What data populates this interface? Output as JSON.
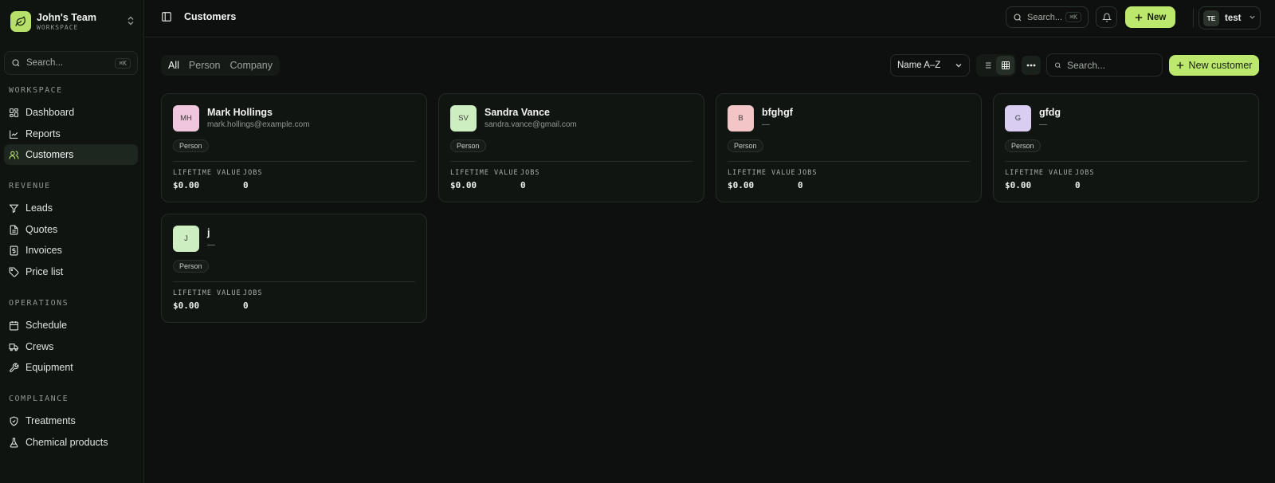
{
  "workspace": {
    "name": "John's Team",
    "label": "WORKSPACE"
  },
  "sidebar": {
    "search_label": "Search...",
    "search_shortcut": "⌘K",
    "sections": [
      {
        "title": "WORKSPACE",
        "items": [
          {
            "label": "Dashboard",
            "icon": "dashboard-icon"
          },
          {
            "label": "Reports",
            "icon": "chart-line-icon"
          },
          {
            "label": "Customers",
            "icon": "users-icon",
            "active": true
          }
        ]
      },
      {
        "title": "REVENUE",
        "items": [
          {
            "label": "Leads",
            "icon": "filter-icon"
          },
          {
            "label": "Quotes",
            "icon": "document-icon"
          },
          {
            "label": "Invoices",
            "icon": "invoice-icon"
          },
          {
            "label": "Price list",
            "icon": "tag-icon"
          }
        ]
      },
      {
        "title": "OPERATIONS",
        "items": [
          {
            "label": "Schedule",
            "icon": "calendar-icon"
          },
          {
            "label": "Crews",
            "icon": "truck-icon"
          },
          {
            "label": "Equipment",
            "icon": "wrench-icon"
          }
        ]
      },
      {
        "title": "COMPLIANCE",
        "items": [
          {
            "label": "Treatments",
            "icon": "shield-icon"
          },
          {
            "label": "Chemical products",
            "icon": "flask-icon"
          }
        ]
      }
    ]
  },
  "topbar": {
    "title": "Customers",
    "search_label": "Search...",
    "search_shortcut": "⌘K",
    "new_label": "New",
    "user_initials": "TE",
    "user_name": "test"
  },
  "toolbar": {
    "filters": [
      "All",
      "Person",
      "Company"
    ],
    "active_filter": "All",
    "sort_label": "Name A–Z",
    "search_placeholder": "Search...",
    "new_customer_label": "New customer"
  },
  "colors": {
    "accent": "#bde86e",
    "background": "#0d100e"
  },
  "customers": [
    {
      "initials": "MH",
      "name": "Mark Hollings",
      "email": "mark.hollings@example.com",
      "type": "Person",
      "lifetime_label": "LIFETIME VALUE",
      "lifetime_value": "$0.00",
      "jobs_label": "JOBS",
      "jobs": "0",
      "avatar_color": "#f0c6dc"
    },
    {
      "initials": "SV",
      "name": "Sandra Vance",
      "email": "sandra.vance@gmail.com",
      "type": "Person",
      "lifetime_label": "LIFETIME VALUE",
      "lifetime_value": "$0.00",
      "jobs_label": "JOBS",
      "jobs": "0",
      "avatar_color": "#cdeec0"
    },
    {
      "initials": "B",
      "name": "bfghgf",
      "email": "—",
      "type": "Person",
      "lifetime_label": "LIFETIME VALUE",
      "lifetime_value": "$0.00",
      "jobs_label": "JOBS",
      "jobs": "0",
      "avatar_color": "#f2c6c6"
    },
    {
      "initials": "G",
      "name": "gfdg",
      "email": "—",
      "type": "Person",
      "lifetime_label": "LIFETIME VALUE",
      "lifetime_value": "$0.00",
      "jobs_label": "JOBS",
      "jobs": "0",
      "avatar_color": "#d9cdf2"
    },
    {
      "initials": "J",
      "name": "j",
      "email": "—",
      "type": "Person",
      "lifetime_label": "LIFETIME VALUE",
      "lifetime_value": "$0.00",
      "jobs_label": "JOBS",
      "jobs": "0",
      "avatar_color": "#cdeec0"
    }
  ]
}
